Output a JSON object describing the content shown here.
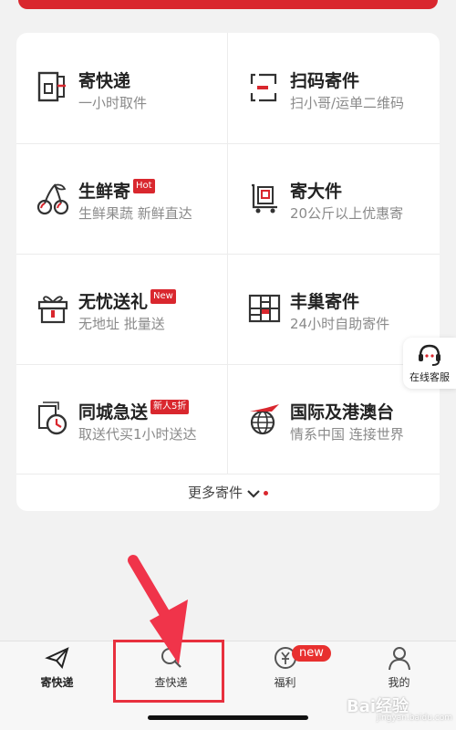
{
  "services": [
    {
      "title": "寄快递",
      "subtitle": "一小时取件",
      "icon": "express-door-icon"
    },
    {
      "title": "扫码寄件",
      "subtitle": "扫小哥/运单二维码",
      "icon": "scan-code-icon"
    },
    {
      "title": "生鲜寄",
      "badge": "Hot",
      "subtitle": "生鲜果蔬 新鲜直达",
      "icon": "cherry-icon"
    },
    {
      "title": "寄大件",
      "subtitle": "20公斤以上优惠寄",
      "icon": "large-parcel-cart-icon"
    },
    {
      "title": "无忧送礼",
      "badge": "New",
      "subtitle": "无地址 批量送",
      "icon": "gift-box-icon"
    },
    {
      "title": "丰巢寄件",
      "subtitle": "24小时自助寄件",
      "icon": "locker-icon"
    },
    {
      "title": "同城急送",
      "badge": "新人5折",
      "subtitle": "取送代买1小时送达",
      "icon": "clock-parcel-icon"
    },
    {
      "title": "国际及港澳台",
      "subtitle": "情系中国 连接世界",
      "icon": "globe-plane-icon"
    }
  ],
  "more_label": "更多寄件",
  "customer_service_label": "在线客服",
  "tabs": [
    {
      "label": "寄快递",
      "icon": "paper-plane-icon"
    },
    {
      "label": "查快递",
      "icon": "search-icon"
    },
    {
      "label": "福利",
      "icon": "yen-coin-icon",
      "badge": "new"
    },
    {
      "label": "我的",
      "icon": "person-icon"
    }
  ],
  "watermark": "Bai经验",
  "watermark_sub": "jingyan.baidu.com",
  "colors": {
    "accent": "#d9272e",
    "annotation": "#e8303e"
  }
}
